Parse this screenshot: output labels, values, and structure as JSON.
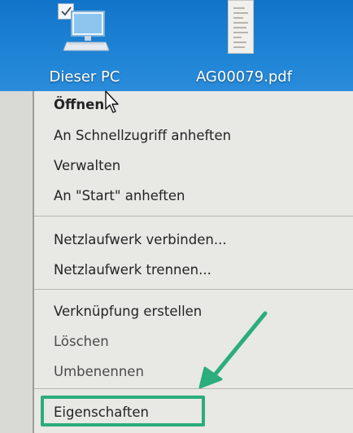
{
  "desktop": {
    "icons": [
      {
        "label": "Dieser PC",
        "icon": "computer-icon",
        "selected": true
      },
      {
        "label": "AG00079.pdf",
        "icon": "pdf-file-icon"
      }
    ]
  },
  "context_menu": {
    "items": [
      {
        "label": "Öffnen",
        "default": true
      },
      {
        "label": "An Schnellzugriff anheften"
      },
      {
        "label": "Verwalten"
      },
      {
        "label": "An \"Start\" anheften"
      },
      {
        "label": "Netzlaufwerk verbinden..."
      },
      {
        "label": "Netzlaufwerk trennen..."
      },
      {
        "label": "Verknüpfung erstellen"
      },
      {
        "label": "Löschen"
      },
      {
        "label": "Umbenennen"
      },
      {
        "label": "Eigenschaften",
        "highlighted": true
      }
    ]
  },
  "annotation": {
    "color": "#2bad7c",
    "target": "Eigenschaften"
  }
}
